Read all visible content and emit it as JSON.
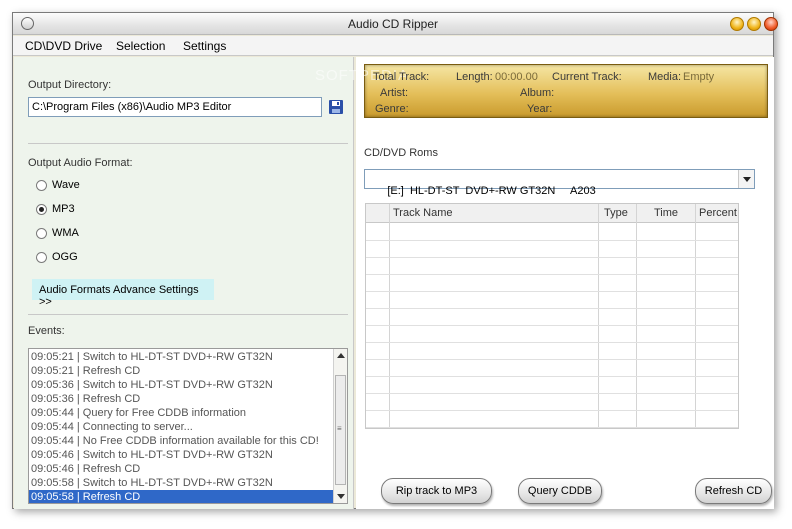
{
  "window": {
    "title": "Audio CD Ripper"
  },
  "menu": {
    "items": [
      "CD\\DVD Drive",
      "Selection",
      "Settings"
    ]
  },
  "output": {
    "directory_label": "Output Directory:",
    "directory_value": "C:\\Program Files (x86)\\Audio MP3 Editor",
    "format_label": "Output Audio Format:",
    "formats": [
      {
        "label": "Wave",
        "checked": false
      },
      {
        "label": "MP3",
        "checked": true
      },
      {
        "label": "WMA",
        "checked": false
      },
      {
        "label": "OGG",
        "checked": false
      }
    ],
    "advanced_label": "Audio Formats Advance Settings >>"
  },
  "events": {
    "label": "Events:",
    "lines": [
      "09:05:21 | Switch to HL-DT-ST DVD+-RW GT32N",
      "09:05:21 | Refresh CD",
      "09:05:36 | Switch to HL-DT-ST DVD+-RW GT32N",
      "09:05:36 | Refresh CD",
      "09:05:44 | Query for Free CDDB information",
      "09:05:44 | Connecting to  server...",
      "09:05:44 | No Free CDDB information available for this CD!",
      "09:05:46 | Switch to HL-DT-ST DVD+-RW GT32N",
      "09:05:46 | Refresh CD",
      "09:05:58 | Switch to HL-DT-ST DVD+-RW GT32N",
      "09:05:58 | Refresh CD"
    ],
    "selected_index": 10
  },
  "info": {
    "total_track": "Total Track:",
    "length_label": "Length:",
    "length_value": "00:00.00",
    "current_track": "Current Track:",
    "media_label": "Media:",
    "media_value": "Empty",
    "artist": "Artist:",
    "album": "Album:",
    "genre": "Genre:",
    "year": "Year:",
    "watermark": "SOFTPEDIA"
  },
  "drives": {
    "label": "CD/DVD Roms",
    "selected": "[E:]  HL-DT-ST  DVD+-RW GT32N     A203"
  },
  "tracks": {
    "columns": [
      "Track Name",
      "Type",
      "Time",
      "Percent"
    ],
    "rows": []
  },
  "buttons": {
    "rip": "Rip track to MP3",
    "query": "Query CDDB",
    "refresh": "Refresh CD"
  },
  "colors": {
    "left_panel": "#eef4ec",
    "advanced_button": "#cff2f4",
    "info_gold": "#e4bf5a",
    "selection_blue": "#2f68c8"
  }
}
